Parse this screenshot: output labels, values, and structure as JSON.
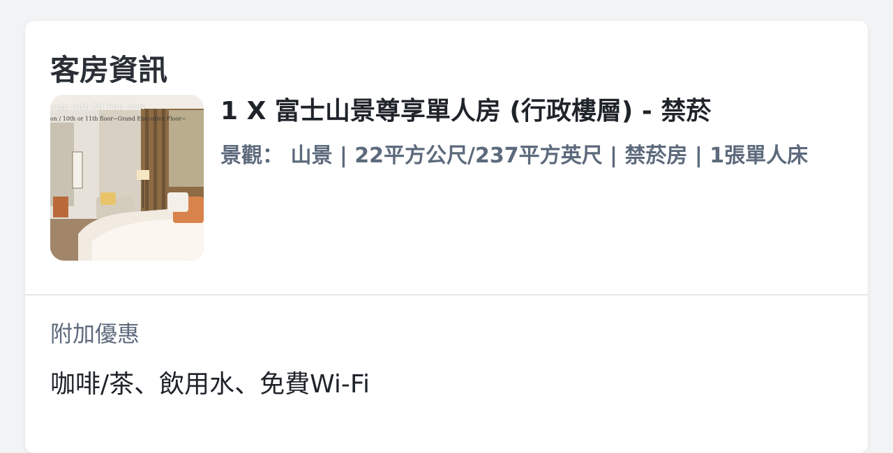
{
  "room_info": {
    "title": "客房資訊",
    "room_name": "1 X 富士山景尊享單人房 (行政樓層) - 禁菸",
    "details": "景觀： 山景 | 22平方公尺/237平方英尺 | 禁菸房 | 1張單人床",
    "photo": {
      "caption_top": "oom with Mt Fuji view",
      "caption_sub": "on / 10th or 11th floor~Grand Executive Floor~"
    }
  },
  "perks": {
    "label": "附加優惠",
    "value": "咖啡/茶、飲用水、免費Wi-Fi"
  },
  "colors": {
    "heading": "#2a2f37",
    "body_text": "#1f232a",
    "muted_text": "#5d6a7c",
    "divider": "#e3e6ea",
    "card_bg": "#ffffff"
  }
}
